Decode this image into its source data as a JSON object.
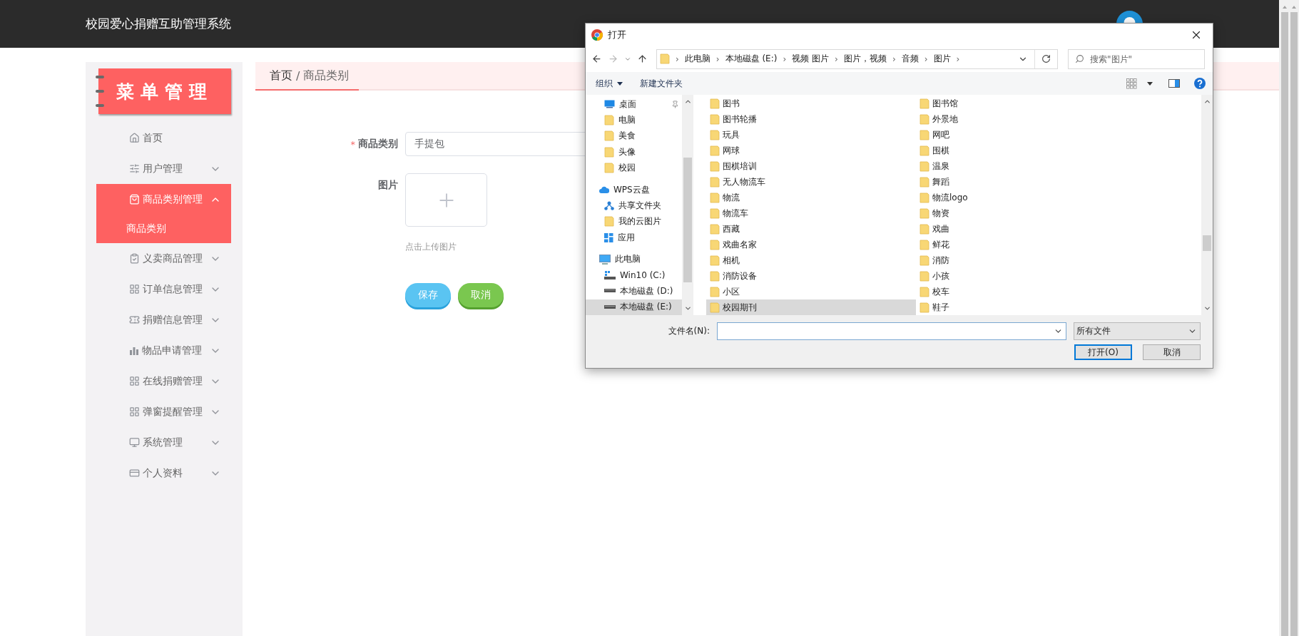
{
  "header": {
    "title": "校园爱心捐赠互助管理系统"
  },
  "sidebar": {
    "banner": "菜单管理",
    "items": [
      {
        "label": "首页",
        "kind": "link",
        "selected": false
      },
      {
        "label": "用户管理",
        "kind": "menu",
        "selected": false,
        "expanded": false
      },
      {
        "label": "商品类别管理",
        "kind": "menu",
        "selected": true,
        "expanded": true,
        "children": [
          {
            "label": "商品类别"
          }
        ]
      },
      {
        "label": "义卖商品管理",
        "kind": "menu",
        "selected": false,
        "expanded": false
      },
      {
        "label": "订单信息管理",
        "kind": "menu",
        "selected": false,
        "expanded": false
      },
      {
        "label": "捐赠信息管理",
        "kind": "menu",
        "selected": false,
        "expanded": false
      },
      {
        "label": "物品申请管理",
        "kind": "menu",
        "selected": false,
        "expanded": false
      },
      {
        "label": "在线捐赠管理",
        "kind": "menu",
        "selected": false,
        "expanded": false
      },
      {
        "label": "弹窗提醒管理",
        "kind": "menu",
        "selected": false,
        "expanded": false
      },
      {
        "label": "系统管理",
        "kind": "menu",
        "selected": false,
        "expanded": false
      },
      {
        "label": "个人资料",
        "kind": "menu",
        "selected": false,
        "expanded": false
      }
    ]
  },
  "breadcrumb": {
    "items": [
      "首页",
      "商品类别"
    ],
    "separator": "/"
  },
  "form": {
    "required_mark": "*",
    "fields": [
      {
        "kind": "text",
        "label": "商品类别",
        "required": true,
        "value": "手提包"
      },
      {
        "kind": "upload",
        "label": "图片",
        "required": false,
        "hint": "点击上传图片"
      }
    ],
    "buttons": [
      {
        "label": "保存",
        "kind": "primary"
      },
      {
        "label": "取消",
        "kind": "success"
      }
    ]
  },
  "dialog": {
    "title": "打开",
    "address": {
      "path": [
        "此电脑",
        "本地磁盘 (E:)",
        "视频 图片",
        "图片，视频",
        "音频",
        "图片"
      ],
      "separator": "›"
    },
    "search": {
      "placeholder": "搜索\"图片\""
    },
    "toolbar": {
      "organize": "组织",
      "new_folder": "新建文件夹"
    },
    "nav_pane": {
      "quick_access": [
        {
          "label": "桌面",
          "kind": "desktop",
          "pinned": true,
          "selected": false
        },
        {
          "label": "电脑",
          "kind": "folder",
          "pinned": false,
          "selected": false
        },
        {
          "label": "美食",
          "kind": "folder",
          "pinned": false,
          "selected": false
        },
        {
          "label": "头像",
          "kind": "folder",
          "pinned": false,
          "selected": false
        },
        {
          "label": "校园",
          "kind": "folder",
          "pinned": false,
          "selected": false
        }
      ],
      "tree": [
        {
          "label": "WPS云盘",
          "kind": "cloud",
          "selected": false,
          "children": [
            {
              "label": "共享文件夹",
              "kind": "share",
              "selected": false
            },
            {
              "label": "我的云图片",
              "kind": "folder",
              "selected": false
            },
            {
              "label": "应用",
              "kind": "apps",
              "selected": false
            }
          ]
        },
        {
          "label": "此电脑",
          "kind": "pc",
          "selected": false,
          "children": [
            {
              "label": "Win10 (C:)",
              "kind": "system-drive",
              "selected": false
            },
            {
              "label": "本地磁盘 (D:)",
              "kind": "drive",
              "selected": false
            },
            {
              "label": "本地磁盘 (E:)",
              "kind": "drive",
              "selected": true
            }
          ]
        }
      ]
    },
    "files": [
      {
        "label": "图书",
        "selected": false
      },
      {
        "label": "图书轮播",
        "selected": false
      },
      {
        "label": "玩具",
        "selected": false
      },
      {
        "label": "网球",
        "selected": false
      },
      {
        "label": "围棋培训",
        "selected": false
      },
      {
        "label": "无人物流车",
        "selected": false
      },
      {
        "label": "物流",
        "selected": false
      },
      {
        "label": "物流车",
        "selected": false
      },
      {
        "label": "西藏",
        "selected": false
      },
      {
        "label": "戏曲名家",
        "selected": false
      },
      {
        "label": "相机",
        "selected": false
      },
      {
        "label": "消防设备",
        "selected": false
      },
      {
        "label": "小区",
        "selected": false
      },
      {
        "label": "校园期刊",
        "selected": true
      },
      {
        "label": "图书馆",
        "selected": false
      },
      {
        "label": "外景地",
        "selected": false
      },
      {
        "label": "网吧",
        "selected": false
      },
      {
        "label": "围棋",
        "selected": false
      },
      {
        "label": "温泉",
        "selected": false
      },
      {
        "label": "舞蹈",
        "selected": false
      },
      {
        "label": "物流logo",
        "selected": false
      },
      {
        "label": "物资",
        "selected": false
      },
      {
        "label": "戏曲",
        "selected": false
      },
      {
        "label": "鲜花",
        "selected": false
      },
      {
        "label": "消防",
        "selected": false
      },
      {
        "label": "小孩",
        "selected": false
      },
      {
        "label": "校车",
        "selected": false
      },
      {
        "label": "鞋子",
        "selected": false
      }
    ],
    "filename": {
      "label": "文件名(N):"
    },
    "filter": {
      "value": "所有文件"
    },
    "buttons": [
      {
        "label": "打开(O)",
        "kind": "default"
      },
      {
        "label": "取消",
        "kind": "normal"
      }
    ]
  }
}
